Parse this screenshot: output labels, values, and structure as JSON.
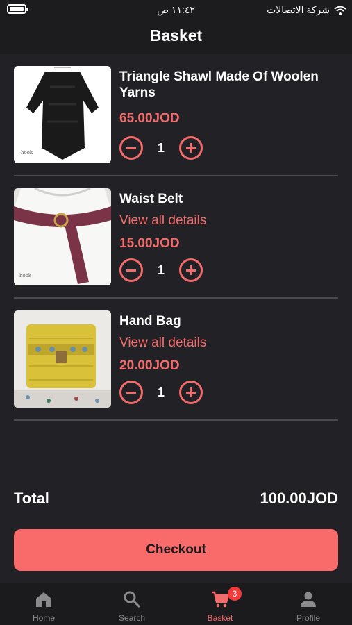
{
  "status_bar": {
    "time": "١١:٤٢ ص",
    "carrier": "شركة الاتصالات"
  },
  "header": {
    "title": "Basket"
  },
  "items": [
    {
      "name": "Triangle Shawl Made Of Woolen Yarns",
      "details": "",
      "price": "65.00JOD",
      "quantity": "1"
    },
    {
      "name": "Waist Belt",
      "details": "View all details",
      "price": "15.00JOD",
      "quantity": "1"
    },
    {
      "name": "Hand Bag",
      "details": "View all details",
      "price": "20.00JOD",
      "quantity": "1"
    }
  ],
  "summary": {
    "total_label": "Total",
    "total_value": "100.00JOD"
  },
  "checkout": {
    "label": "Checkout"
  },
  "tabbar": {
    "tabs": [
      {
        "label": "Home",
        "icon": "home-icon"
      },
      {
        "label": "Search",
        "icon": "search-icon"
      },
      {
        "label": "Basket",
        "icon": "cart-icon",
        "badge": "3"
      },
      {
        "label": "Profile",
        "icon": "person-icon"
      }
    ]
  },
  "colors": {
    "accent": "#f46b6b",
    "button": "#f96b6b",
    "background": "#222226"
  }
}
